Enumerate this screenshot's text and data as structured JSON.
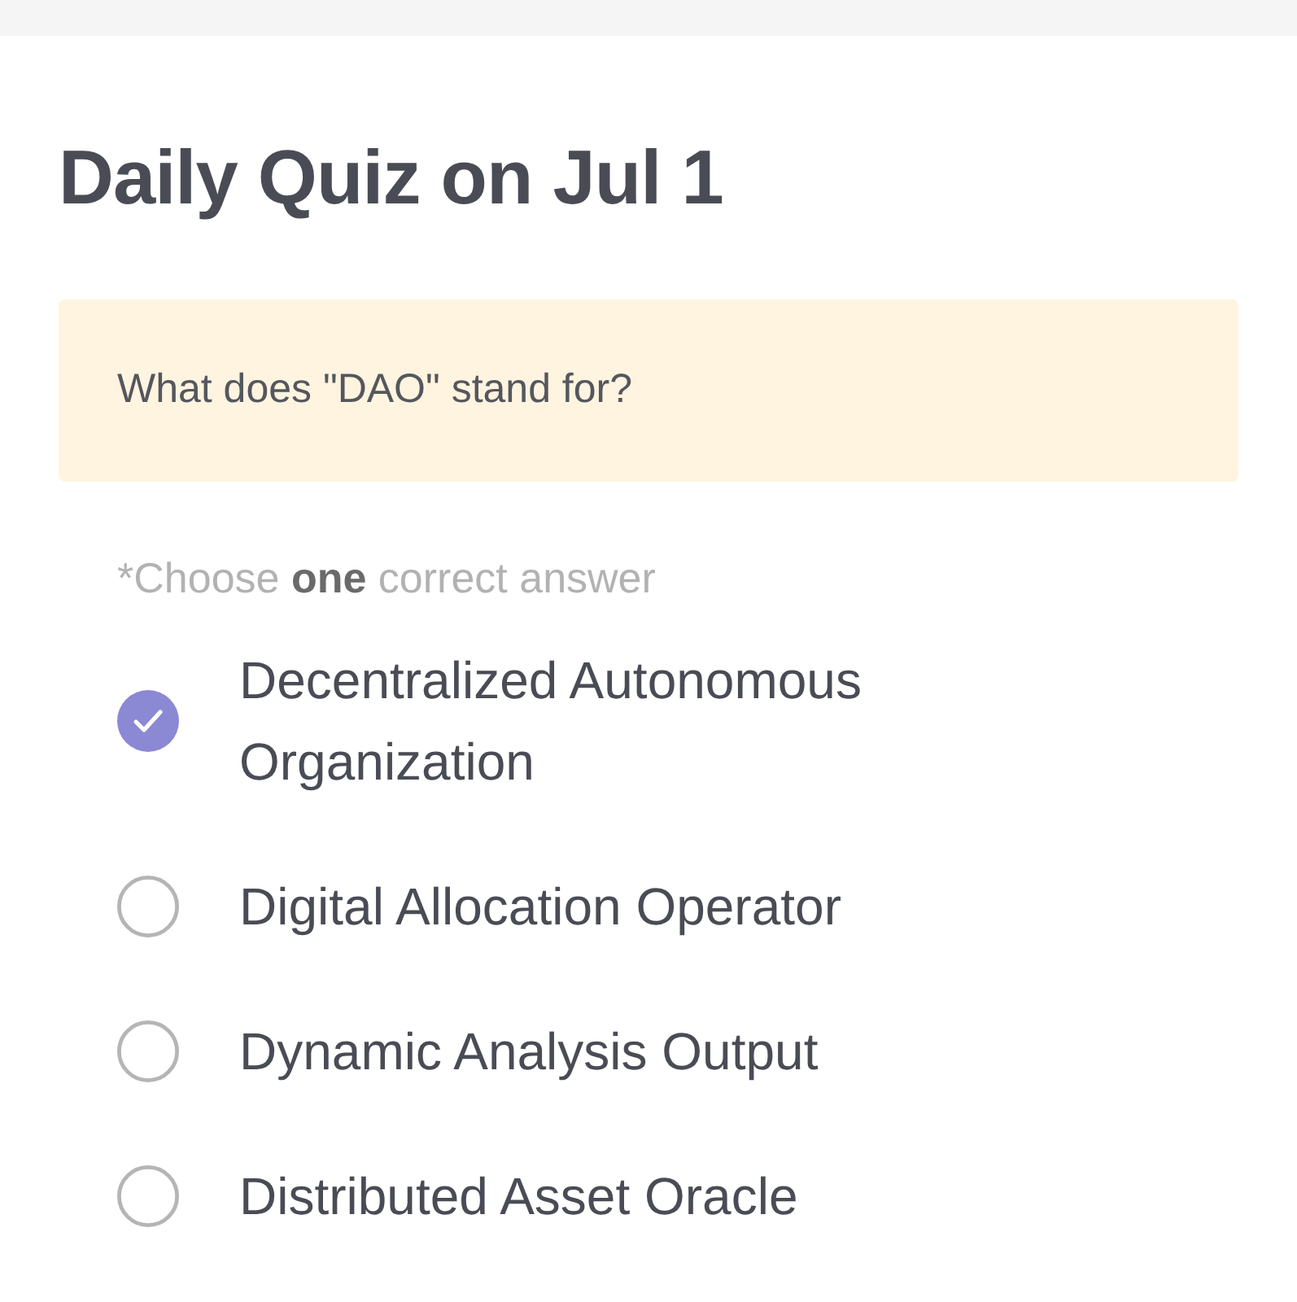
{
  "title": "Daily Quiz on Jul 1",
  "question": "What does \"DAO\" stand for?",
  "instruction": "*Choose **one** correct answer",
  "options": [
    {
      "label": "Decentralized Autonomous Organization",
      "selected": true
    },
    {
      "label": "Digital Allocation Operator",
      "selected": false
    },
    {
      "label": "Dynamic Analysis Output",
      "selected": false
    },
    {
      "label": "Distributed Asset Oracle",
      "selected": false
    }
  ]
}
